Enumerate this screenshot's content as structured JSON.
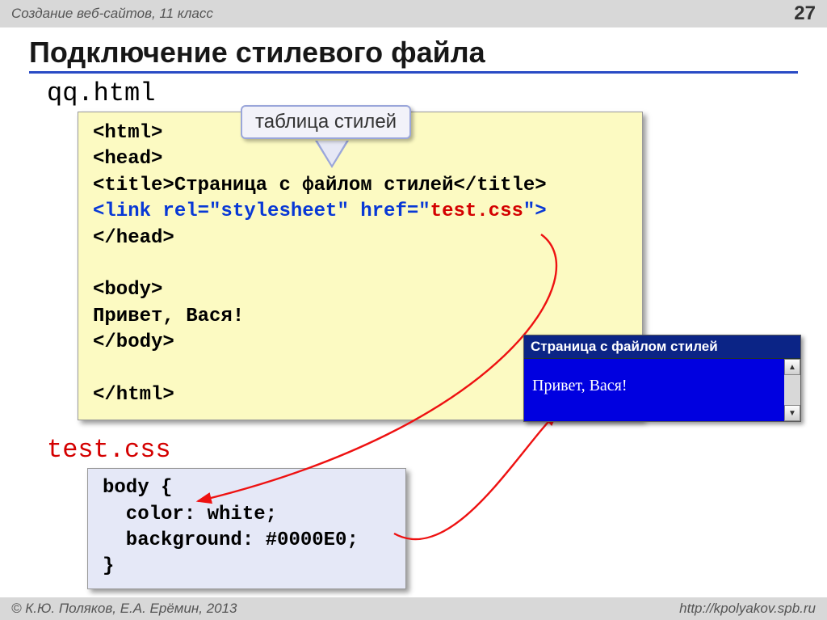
{
  "header": {
    "breadcrumb": "Создание веб-сайтов, 11 класс",
    "page_number": "27"
  },
  "slide_title": "Подключение стилевого файла",
  "html_file": {
    "name": "qq.html",
    "callout": "таблица стилей",
    "lines": {
      "l1": "<html>",
      "l2": "<head>",
      "l3a": "<title>",
      "l3b": "Страница с файлом стилей",
      "l3c": "</title>",
      "l4a": "<link rel=\"stylesheet\" href=\"",
      "l4b": "test.css",
      "l4c": "\">",
      "l5": "</head>",
      "gap": "",
      "l6": "<body>",
      "l7": "Привет, Вася!",
      "l8": "</body>",
      "gap2": "",
      "l9": "</html>"
    }
  },
  "css_file": {
    "name": "test.css",
    "code": "body {\n  color: white;\n  background: #0000E0;\n}"
  },
  "preview": {
    "title": "Страница с файлом стилей",
    "body": "Привет, Вася!",
    "scroll_up": "▲",
    "scroll_down": "▼"
  },
  "footer": {
    "copyright": "© К.Ю. Поляков, Е.А. Ерёмин, 2013",
    "url": "http://kpolyakov.spb.ru"
  }
}
